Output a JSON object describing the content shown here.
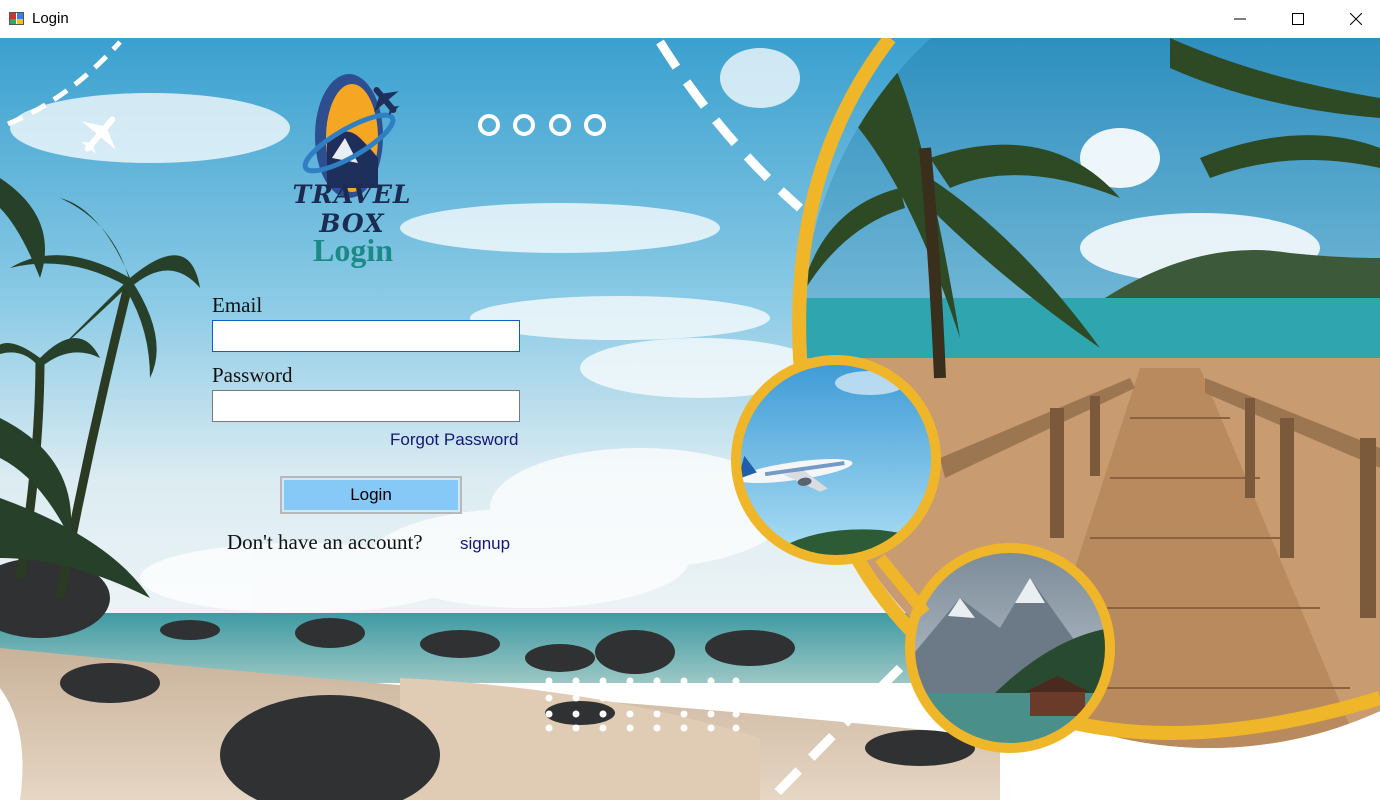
{
  "window": {
    "title": "Login",
    "controls": [
      "minimize",
      "maximize",
      "close"
    ]
  },
  "logo": {
    "text": "TRAVEL BOX",
    "icon": "airplane-globe-logo"
  },
  "form": {
    "heading": "Login",
    "email_label": "Email",
    "email_value": "",
    "password_label": "Password",
    "password_value": "",
    "forgot_link": "Forgot Password",
    "login_button": "Login",
    "no_account_text": "Don't have an account?",
    "signup_link": "signup"
  },
  "colors": {
    "accent_ring": "#f0b62a",
    "heading": "#1b8a86",
    "button": "#86c9f7",
    "link": "#15157a",
    "logo_text": "#1d2a52"
  },
  "decor": {
    "page_indicator_dots": 4,
    "photos": [
      "palm-beach-boardwalk",
      "airplane-in-sky",
      "mountain-lake-cabin"
    ]
  }
}
